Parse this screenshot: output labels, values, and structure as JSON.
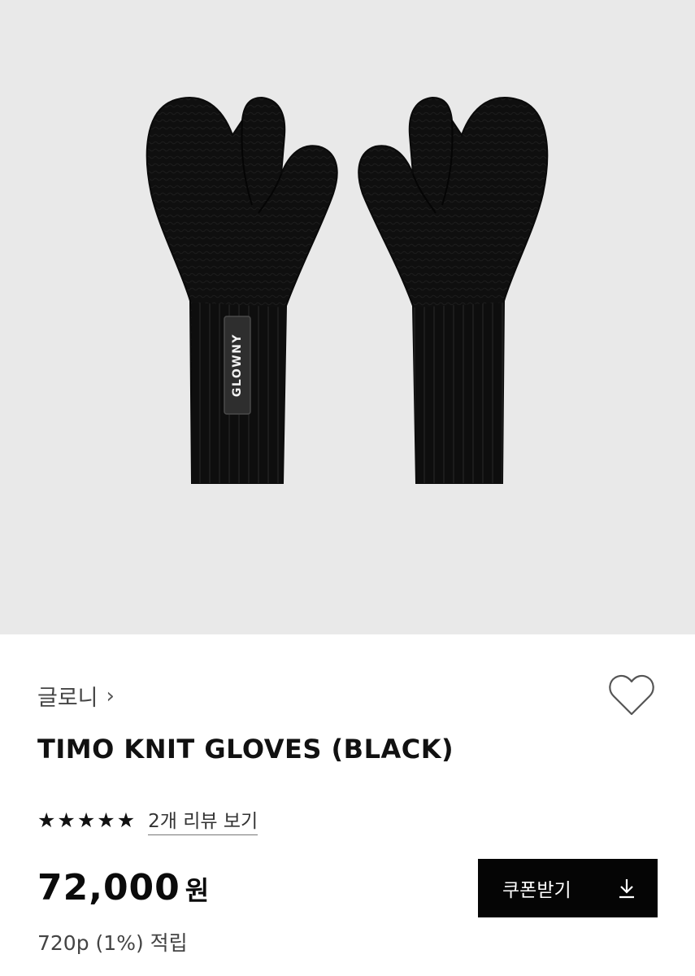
{
  "product_image": {
    "tag_text": "GLOWNY",
    "background": "#e9e9e9"
  },
  "brand": {
    "name": "글로니",
    "chevron_icon": "chevron-right-icon"
  },
  "wishlist": {
    "icon": "heart-outline-icon"
  },
  "product": {
    "title": "TIMO KNIT GLOVES (BLACK)"
  },
  "rating": {
    "stars": 5,
    "star_glyphs": [
      "★",
      "★",
      "★",
      "★",
      "★"
    ],
    "review_link": "2개 리뷰 보기"
  },
  "price": {
    "amount": "72,000",
    "unit": "원"
  },
  "points": {
    "text": "720p (1%) 적립"
  },
  "coupon": {
    "label": "쿠폰받기",
    "icon": "download-icon",
    "background": "#050505"
  }
}
